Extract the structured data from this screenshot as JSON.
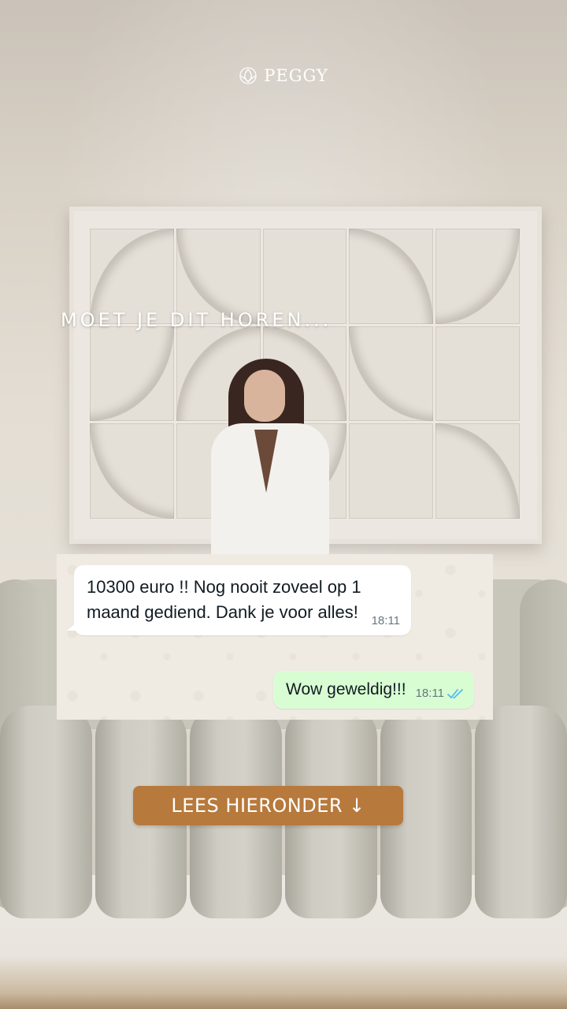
{
  "brand": {
    "name": "PEGGY",
    "logo_icon": "lotus-leaf-icon"
  },
  "headline": "MOET JE DIT HOREN...",
  "chat": {
    "incoming": {
      "text": "10300 euro !! Nog nooit zoveel op 1 maand gediend. Dank je voor alles!",
      "time": "18:11"
    },
    "outgoing": {
      "text": "Wow geweldig!!!",
      "time": "18:11",
      "status_icon": "double-check-read-icon",
      "status_color": "#53bdeb"
    }
  },
  "cta": {
    "label": "LEES HIERONDER",
    "arrow": "↓",
    "color": "#b7793c"
  }
}
